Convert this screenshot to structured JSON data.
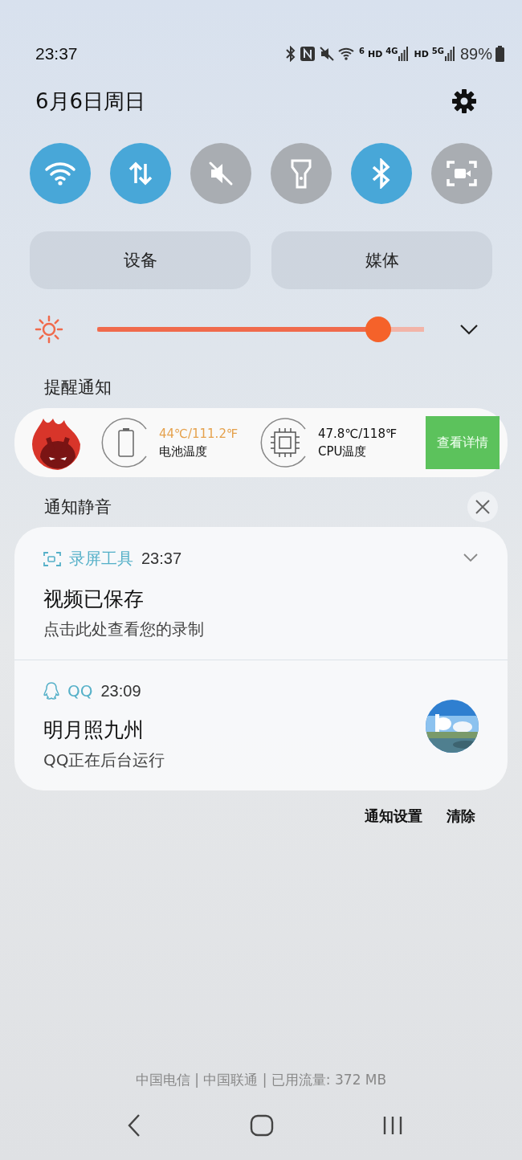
{
  "status_bar": {
    "time": "23:37",
    "wifi_badge": "6",
    "networks": [
      {
        "hd": "HD",
        "type": "4G"
      },
      {
        "hd": "HD",
        "type": "5G"
      }
    ],
    "battery": "89%"
  },
  "date": "6月6日周日",
  "toggles": [
    {
      "on": true
    },
    {
      "on": true
    },
    {
      "on": false
    },
    {
      "on": false
    },
    {
      "on": true
    },
    {
      "on": false
    }
  ],
  "panel_buttons": [
    "设备",
    "媒体"
  ],
  "brightness": {
    "level": 0.86
  },
  "alert_section": {
    "title": "提醒通知"
  },
  "temp_widget": {
    "battery_reading": "44℃/111.2℉",
    "battery_label": "电池温度",
    "cpu_reading": "47.8℃/118℉",
    "cpu_label": "CPU温度",
    "button": "查看详情"
  },
  "silent_section": {
    "title": "通知静音"
  },
  "notifications": [
    {
      "kind": "expandable",
      "app": "录屏工具",
      "time": "23:37",
      "title": "视频已保存",
      "text": "点击此处查看您的录制"
    },
    {
      "kind": "avatar",
      "app": "QQ",
      "time": "23:09",
      "title": "明月照九州",
      "text": "QQ正在后台运行"
    }
  ],
  "actions": [
    "通知设置",
    "清除"
  ],
  "carrier_line": "中国电信 | 中国联通 | 已用流量: 372 MB"
}
